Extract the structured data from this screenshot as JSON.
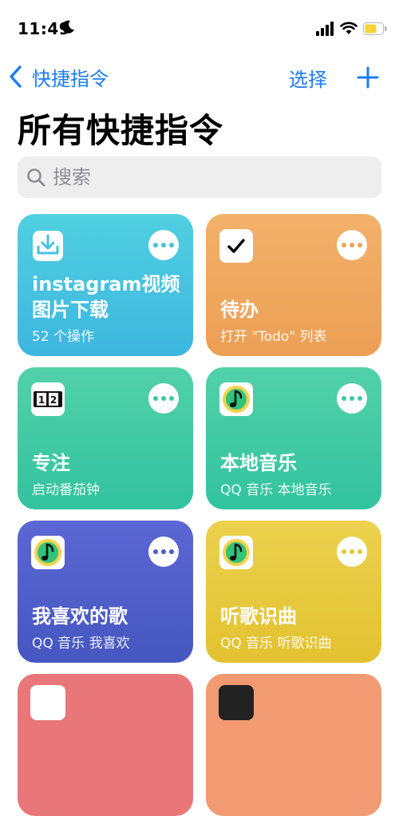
{
  "status_bar": {
    "time": "11:49"
  },
  "nav": {
    "back_label": "快捷指令",
    "select_label": "选择"
  },
  "page_title": "所有快捷指令",
  "search": {
    "placeholder": "搜索"
  },
  "shortcuts": [
    {
      "name": "instagram视频图片下载",
      "subtitle": "52 个操作",
      "icon": "download-icon",
      "color": "#45c2df"
    },
    {
      "name": "待办",
      "subtitle": "打开 \"Todo\" 列表",
      "icon": "checkmark-icon",
      "color": "#eea55c"
    },
    {
      "name": "专注",
      "subtitle": "启动番茄钟",
      "icon": "flip-clock-icon",
      "color": "#3ec8a3"
    },
    {
      "name": "本地音乐",
      "subtitle": "QQ 音乐 本地音乐",
      "icon": "qq-music-icon",
      "color": "#3ec8a3"
    },
    {
      "name": "我喜欢的歌",
      "subtitle": "QQ 音乐 我喜欢",
      "icon": "qq-music-icon",
      "color": "#4e5ec8"
    },
    {
      "name": "听歌识曲",
      "subtitle": "QQ 音乐 听歌识曲",
      "icon": "qq-music-icon",
      "color": "#e6c738"
    }
  ]
}
